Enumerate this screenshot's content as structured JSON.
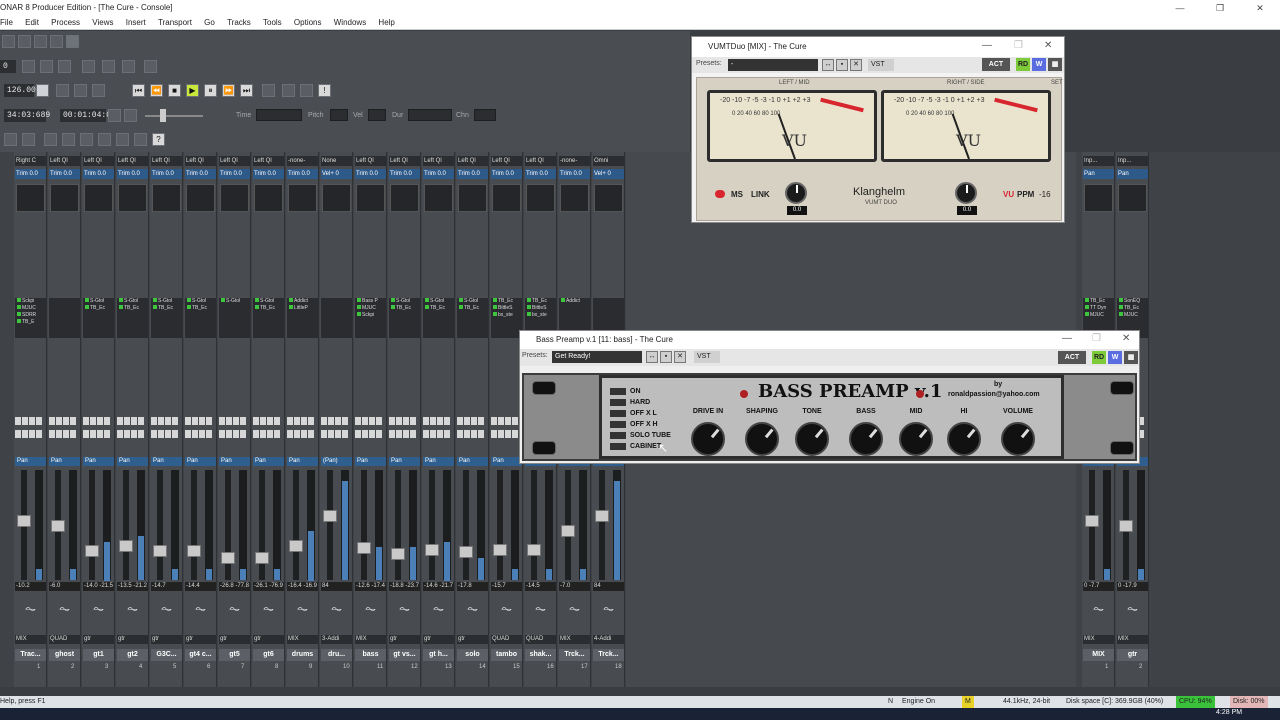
{
  "window": {
    "title": "ONAR 8 Producer Edition - [The Cure - Console]",
    "controls": [
      "—",
      "❐",
      "✕"
    ]
  },
  "menu": [
    "File",
    "Edit",
    "Process",
    "Views",
    "Insert",
    "Transport",
    "Go",
    "Tracks",
    "Tools",
    "Options",
    "Windows",
    "Help"
  ],
  "toolbar": {
    "counter_zero": "0",
    "tempo": "126.00",
    "now_time": "34:03:689",
    "elapsed": "00:01:04:05",
    "labels": {
      "time": "Time",
      "pitch": "Pitch",
      "vel": "Vel",
      "dur": "Dur",
      "chn": "Chn"
    }
  },
  "strips": [
    {
      "hdr": "Right C",
      "trim": "Trim 0.0",
      "fx": [
        "Sckpi",
        "MJUC",
        "SDRR",
        "TB_E"
      ],
      "pan": "Pan",
      "val": "-10.2",
      "out": "MIX",
      "name": "Trac...",
      "num": "1"
    },
    {
      "hdr": "Left Ql",
      "trim": "Trim 0.0",
      "fx": [],
      "pan": "Pan",
      "val": "-6.0",
      "out": "QUAD",
      "name": "ghost",
      "num": "2"
    },
    {
      "hdr": "Left Ql",
      "trim": "Trim 0.0",
      "fx": [
        "S-Gtol",
        "TB_Ec"
      ],
      "pan": "Pan",
      "val": "-14.0 -21.5",
      "out": "gtr",
      "name": "gt1",
      "num": "3"
    },
    {
      "hdr": "Left Ql",
      "trim": "Trim 0.0",
      "fx": [
        "S-Gtol",
        "TB_Ec"
      ],
      "pan": "Pan",
      "val": "-13.5 -21.2",
      "out": "gtr",
      "name": "gt2",
      "num": "4"
    },
    {
      "hdr": "Left Ql",
      "trim": "Trim 0.0",
      "fx": [
        "S-Gtol",
        "TB_Ec"
      ],
      "pan": "Pan",
      "val": "-14.7",
      "out": "gtr",
      "name": "G3C...",
      "num": "5"
    },
    {
      "hdr": "Left Ql",
      "trim": "Trim 0.0",
      "fx": [
        "S-Gtol",
        "TB_Ec"
      ],
      "pan": "Pan",
      "val": "-14.4",
      "out": "gtr",
      "name": "gt4 c...",
      "num": "6"
    },
    {
      "hdr": "Left Ql",
      "trim": "Trim 0.0",
      "fx": [
        "S-Gtol"
      ],
      "pan": "Pan",
      "val": "-26.8 -77.8",
      "out": "gtr",
      "name": "gt5",
      "num": "7"
    },
    {
      "hdr": "Left Ql",
      "trim": "Trim 0.0",
      "fx": [
        "S-Gtol",
        "TB_Ec"
      ],
      "pan": "Pan",
      "val": "-26.1 -76.9",
      "out": "gtr",
      "name": "gt6",
      "num": "8"
    },
    {
      "hdr": "-none-",
      "trim": "Trim 0.0",
      "fx": [
        "Addict",
        "LittleP"
      ],
      "pan": "Pan",
      "val": "-16.4 -16.9",
      "out": "MIX",
      "name": "drums",
      "num": "9"
    },
    {
      "hdr": "None",
      "trim": "Vel+ 0",
      "fx": [],
      "pan": "(Pan)",
      "val": "84",
      "out": "3-Addi",
      "name": "dru...",
      "num": "10"
    },
    {
      "hdr": "Left Ql",
      "trim": "Trim 0.0",
      "fx": [
        "Bass P",
        "MJUC",
        "Sckpi"
      ],
      "pan": "Pan",
      "val": "-12.6 -17.4",
      "out": "MIX",
      "name": "bass",
      "num": "11"
    },
    {
      "hdr": "Left Ql",
      "trim": "Trim 0.0",
      "fx": [
        "S-Gtol",
        "TB_Ec"
      ],
      "pan": "Pan",
      "val": "-18.8 -23.7",
      "out": "gtr",
      "name": "gt vs...",
      "num": "12"
    },
    {
      "hdr": "Left Ql",
      "trim": "Trim 0.0",
      "fx": [
        "S-Gtol",
        "TB_Ec"
      ],
      "pan": "Pan",
      "val": "-14.6 -21.7",
      "out": "gtr",
      "name": "gt h...",
      "num": "13"
    },
    {
      "hdr": "Left Ql",
      "trim": "Trim 0.0",
      "fx": [
        "S-Gtol",
        "TB_Ec"
      ],
      "pan": "Pan",
      "val": "-17.8",
      "out": "gtr",
      "name": "solo",
      "num": "14"
    },
    {
      "hdr": "Left Ql",
      "trim": "Trim 0.0",
      "fx": [
        "TB_Ec",
        "BittleS",
        "bx_ste"
      ],
      "pan": "Pan",
      "val": "-15.7",
      "out": "QUAD",
      "name": "tambo",
      "num": "15"
    },
    {
      "hdr": "Left Ql",
      "trim": "Trim 0.0",
      "fx": [
        "TB_Ec",
        "BittleS",
        "bx_ste"
      ],
      "pan": "Pan",
      "val": "-14.5",
      "out": "QUAD",
      "name": "shak...",
      "num": "16"
    },
    {
      "hdr": "-none-",
      "trim": "Trim 0.0",
      "fx": [
        "Addict"
      ],
      "pan": "Pan",
      "val": "-7.0",
      "out": "MIX",
      "name": "Trck...",
      "num": "17"
    },
    {
      "hdr": "Omni",
      "trim": "Vel+ 0",
      "fx": [],
      "pan": "Pan",
      "val": "84",
      "out": "4-Addi",
      "name": "Trck...",
      "num": "18"
    }
  ],
  "right_strips": [
    {
      "hdr": "Inp...",
      "hdr2": "0",
      "pan": "Pan",
      "fx": [
        "TB_Ec",
        "TT Dyn",
        "MJUC"
      ],
      "val": "0 -7.7",
      "out": "MIX",
      "name": "MIX",
      "num": "1"
    },
    {
      "hdr": "Inp...",
      "hdr2": "0",
      "pan": "Pan",
      "fx": [
        "SonEQ",
        "TB_Ec",
        "MJUC"
      ],
      "val": "0 -17.9",
      "out": "MIX",
      "name": "gtr",
      "num": "2"
    }
  ],
  "vuduo": {
    "title": "VUMTDuo [MIX] - The Cure",
    "presets_label": "Presets:",
    "preset_value": "-",
    "format": "VST",
    "left_label": "LEFT / MID",
    "right_label": "RIGHT / SIDE",
    "set_label": "SET",
    "scale": "-20 -10 -7 -5 -3 -1 0 +1 +2 +3",
    "scale_low": "0  20  40  60  80  100",
    "vu": "VU",
    "ms": "MS",
    "link": "LINK",
    "brand": "Klanghelm",
    "model": "VUMT DUO",
    "mode_vu": "VU",
    "mode_ppm": "PPM",
    "ref": "-16",
    "left_knob": "0.0",
    "right_knob": "0.0"
  },
  "bass_preamp": {
    "title": "Bass Preamp v.1 [11: bass] - The Cure",
    "presets_label": "Presets:",
    "preset_value": "Get Ready!",
    "format": "VST",
    "logo": "BASS PREAMP v.1",
    "by": "by",
    "email": "ronaldpassion@yahoo.com",
    "switches": [
      "ON",
      "HARD",
      "OFF X L",
      "OFF X H",
      "SOLO TUBE",
      "CABINET"
    ],
    "knobs": [
      "DRIVE IN",
      "SHAPING",
      "TONE",
      "BASS",
      "MID",
      "HI",
      "VOLUME"
    ]
  },
  "plugin_buttons": {
    "act": "ACT",
    "rd": "RD",
    "w": "W"
  },
  "status": {
    "help": "Help, press F1",
    "n": "N",
    "engine": "Engine On",
    "m": "M",
    "format": "44.1kHz, 24-bit",
    "disk": "Disk space [C]: 369.9GB (40%)",
    "cpu": "CPU: 94%",
    "disk_io": "Disk: 00%"
  },
  "taskbar": {
    "time": "4:28 PM"
  },
  "colors": {
    "accent_green": "#7ecb3a",
    "trim_blue": "#2e5a8a",
    "vu_red": "#d8262e"
  }
}
